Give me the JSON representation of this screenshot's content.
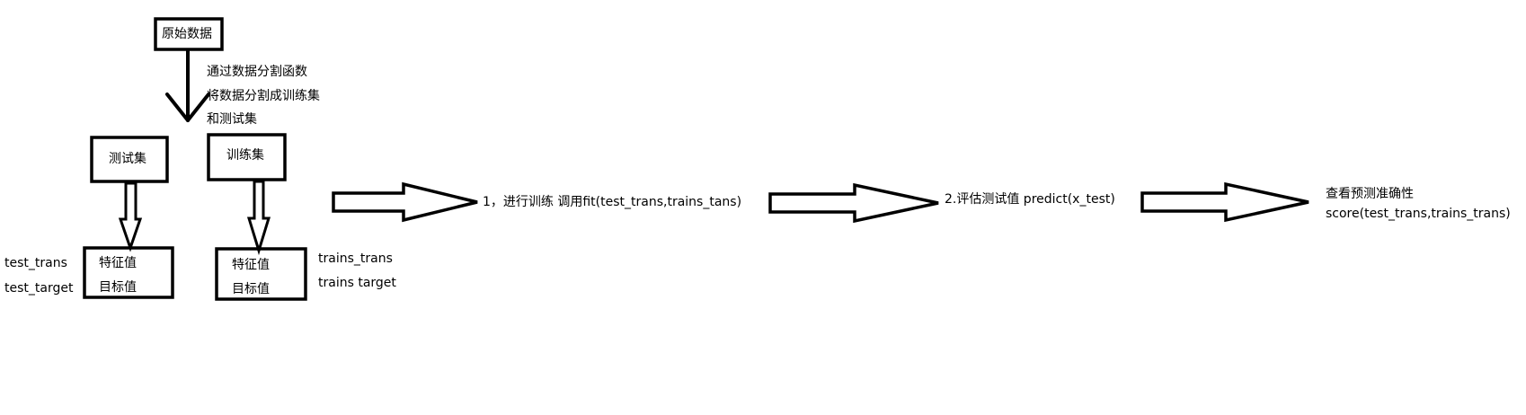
{
  "nodes": {
    "raw_data": "原始数据",
    "test_set": "测试集",
    "train_set": "训练集",
    "test_features": [
      "特征值",
      "目标值"
    ],
    "train_features": [
      "特征值",
      "目标值"
    ]
  },
  "annotations": {
    "split_note": [
      "通过数据分割函数",
      "将数据分割成训练集",
      "和测试集"
    ],
    "test_vars": [
      "test_trans",
      "test_target"
    ],
    "train_vars": [
      "trains_trans",
      "trains  target"
    ]
  },
  "steps": {
    "step1": "1，进行训练 调用fit(test_trans,trains_tans)",
    "step2": "2.评估测试值  predict(x_test)",
    "step3": [
      "查看预测准确性",
      "score(test_trans,trains_trans)"
    ]
  },
  "colors": {
    "stroke": "#000000",
    "fill": "#ffffff",
    "text": "#000000"
  }
}
